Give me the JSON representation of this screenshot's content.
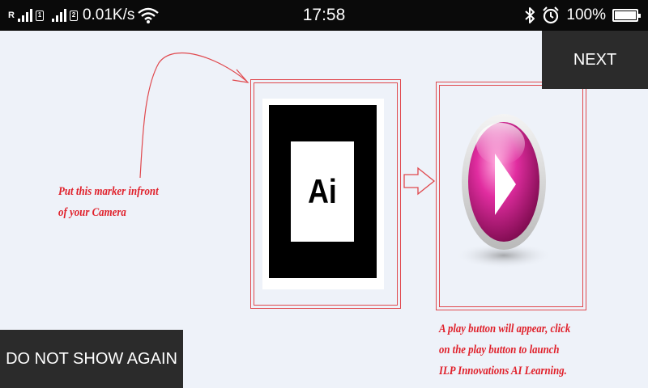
{
  "status_bar": {
    "carrier_indicator": "R",
    "sim1_label": "1",
    "sim2_label": "2",
    "network_speed": "0.01K/s",
    "time": "17:58",
    "battery_percent": "100%",
    "battery_level": 1.0,
    "icons": [
      "signal-icon",
      "sim-icon",
      "wifi-icon",
      "bluetooth-icon",
      "alarm-icon",
      "battery-icon"
    ]
  },
  "buttons": {
    "next_label": "NEXT",
    "dont_show_label": "DO NOT SHOW AGAIN"
  },
  "tutorial": {
    "marker_text": "Ai",
    "left_caption": [
      "Put this marker infront",
      "of your Camera"
    ],
    "right_caption": [
      "A play button will appear, click",
      "on the play button to launch",
      "ILP Innovations AI Learning."
    ]
  },
  "colors": {
    "background": "#eef2f9",
    "accent_red": "#e0484d",
    "caption_red": "#e0202a",
    "play_button_magenta": "#d81b8a",
    "button_dark": "#2b2b2b"
  }
}
